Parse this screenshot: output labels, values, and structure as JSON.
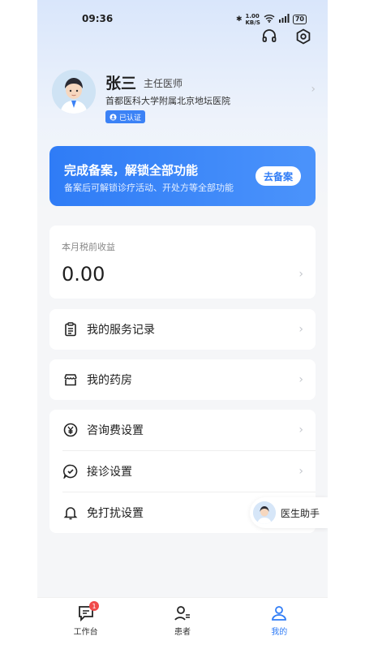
{
  "status": {
    "time": "09:36",
    "net": "1.00",
    "net_unit": "KB/S",
    "battery": "70"
  },
  "profile": {
    "name": "张三",
    "title": "主任医师",
    "hospital": "首都医科大学附属北京地坛医院",
    "badge": "已认证"
  },
  "banner": {
    "title": "完成备案，解锁全部功能",
    "subtitle": "备案后可解锁诊疗活动、开处方等全部功能",
    "button": "去备案"
  },
  "earnings": {
    "label": "本月税前收益",
    "value": "0.00"
  },
  "menu": {
    "service": "我的服务记录",
    "pharmacy": "我的药房",
    "fee": "咨询费设置",
    "reception": "接诊设置",
    "dnd": "免打扰设置"
  },
  "assistant": {
    "label": "医生助手"
  },
  "tabs": [
    {
      "label": "工作台",
      "badge": "1"
    },
    {
      "label": "患者"
    },
    {
      "label": "我的"
    }
  ],
  "colors": {
    "accent": "#2f7cf6",
    "badge_red": "#f04b4b"
  }
}
